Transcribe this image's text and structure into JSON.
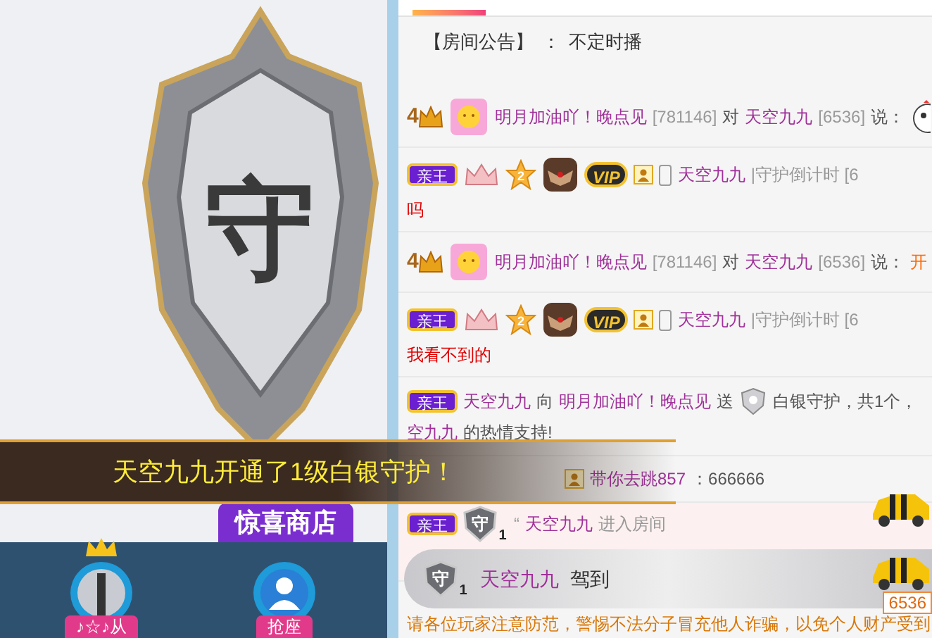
{
  "video": {
    "shield_glyph": "守",
    "shop_label": "惊喜商店"
  },
  "seats": [
    {
      "kind": "occupied",
      "label": "♪☆♪从"
    },
    {
      "kind": "empty",
      "label": "抢座"
    }
  ],
  "banner": {
    "text": "天空九九开通了1级白银守护！"
  },
  "notice": {
    "tag": "【房间公告】",
    "separator": "：",
    "text": "不定时播"
  },
  "messages": [
    {
      "kind": "say",
      "badges": [
        {
          "kind": "level",
          "text": "4"
        },
        {
          "kind": "avatar"
        }
      ],
      "lines": [
        [
          {
            "kind": "name",
            "text": "明月加油吖！晚点见"
          },
          {
            "kind": "gray",
            "text": "[781146]"
          },
          {
            "kind": "plain",
            "text": "对"
          },
          {
            "kind": "name",
            "text": "天空九九"
          },
          {
            "kind": "gray",
            "text": "[6536]"
          },
          {
            "kind": "plain",
            "text": "说："
          },
          {
            "kind": "emoji"
          }
        ]
      ]
    },
    {
      "kind": "chat",
      "badges": [
        {
          "kind": "noble",
          "text": "亲王"
        },
        {
          "kind": "crown"
        },
        {
          "kind": "star",
          "text": "2"
        },
        {
          "kind": "medal"
        },
        {
          "kind": "vip",
          "text": "VIP"
        },
        {
          "kind": "user"
        },
        {
          "kind": "phone"
        }
      ],
      "lines": [
        [
          {
            "kind": "name",
            "text": "天空九九"
          },
          {
            "kind": "gray",
            "text": "|守护倒计时 [6"
          }
        ],
        [
          {
            "kind": "red",
            "text": "吗"
          }
        ]
      ]
    },
    {
      "kind": "say",
      "badges": [
        {
          "kind": "level",
          "text": "4"
        },
        {
          "kind": "avatar"
        }
      ],
      "lines": [
        [
          {
            "kind": "name",
            "text": "明月加油吖！晚点见"
          },
          {
            "kind": "gray",
            "text": "[781146]"
          },
          {
            "kind": "plain",
            "text": "对"
          },
          {
            "kind": "name",
            "text": "天空九九"
          },
          {
            "kind": "gray",
            "text": "[6536]"
          },
          {
            "kind": "plain",
            "text": "说："
          },
          {
            "kind": "orange",
            "text": "开"
          }
        ]
      ]
    },
    {
      "kind": "chat",
      "badges": [
        {
          "kind": "noble",
          "text": "亲王"
        },
        {
          "kind": "crown"
        },
        {
          "kind": "star",
          "text": "2"
        },
        {
          "kind": "medal"
        },
        {
          "kind": "vip",
          "text": "VIP"
        },
        {
          "kind": "user"
        },
        {
          "kind": "phone"
        }
      ],
      "lines": [
        [
          {
            "kind": "name",
            "text": "天空九九"
          },
          {
            "kind": "gray",
            "text": "|守护倒计时 [6"
          }
        ],
        [
          {
            "kind": "red",
            "text": "我看不到的"
          }
        ]
      ]
    },
    {
      "kind": "gift",
      "badges": [
        {
          "kind": "noble",
          "text": "亲王"
        }
      ],
      "lines": [
        [
          {
            "kind": "name",
            "text": "天空九九"
          },
          {
            "kind": "plain",
            "text": "向"
          },
          {
            "kind": "name",
            "text": "明月加油吖！晚点见"
          },
          {
            "kind": "plain",
            "text": "送"
          },
          {
            "kind": "gift"
          },
          {
            "kind": "plain",
            "text": "白银守护，共1个，"
          }
        ],
        [
          {
            "kind": "name",
            "text": "空九九"
          },
          {
            "kind": "plain",
            "text": "的热情支持!"
          }
        ]
      ]
    },
    {
      "kind": "covered",
      "badges": [
        {
          "kind": "user"
        }
      ],
      "lines": [
        [
          {
            "kind": "name",
            "text": "带你去跳857"
          },
          {
            "kind": "plain",
            "text": "：666666"
          }
        ]
      ]
    },
    {
      "kind": "enter",
      "badges": [
        {
          "kind": "noble",
          "text": "亲王"
        },
        {
          "kind": "guard",
          "text": "守",
          "level_text": "1"
        }
      ],
      "lines": [
        [
          {
            "kind": "gray",
            "text": "“"
          },
          {
            "kind": "name",
            "text": "天空九九"
          },
          {
            "kind": "gray",
            "text": "进入房间"
          }
        ]
      ]
    }
  ],
  "toast": {
    "badge": {
      "kind": "guard",
      "text": "守",
      "level_text": "1"
    },
    "name": "天空九九",
    "action": "驾到",
    "room_id": "6536"
  },
  "footer_notice": "请各位玩家注意防范，警惕不法分子冒充他人诈骗，以免个人财产受到"
}
